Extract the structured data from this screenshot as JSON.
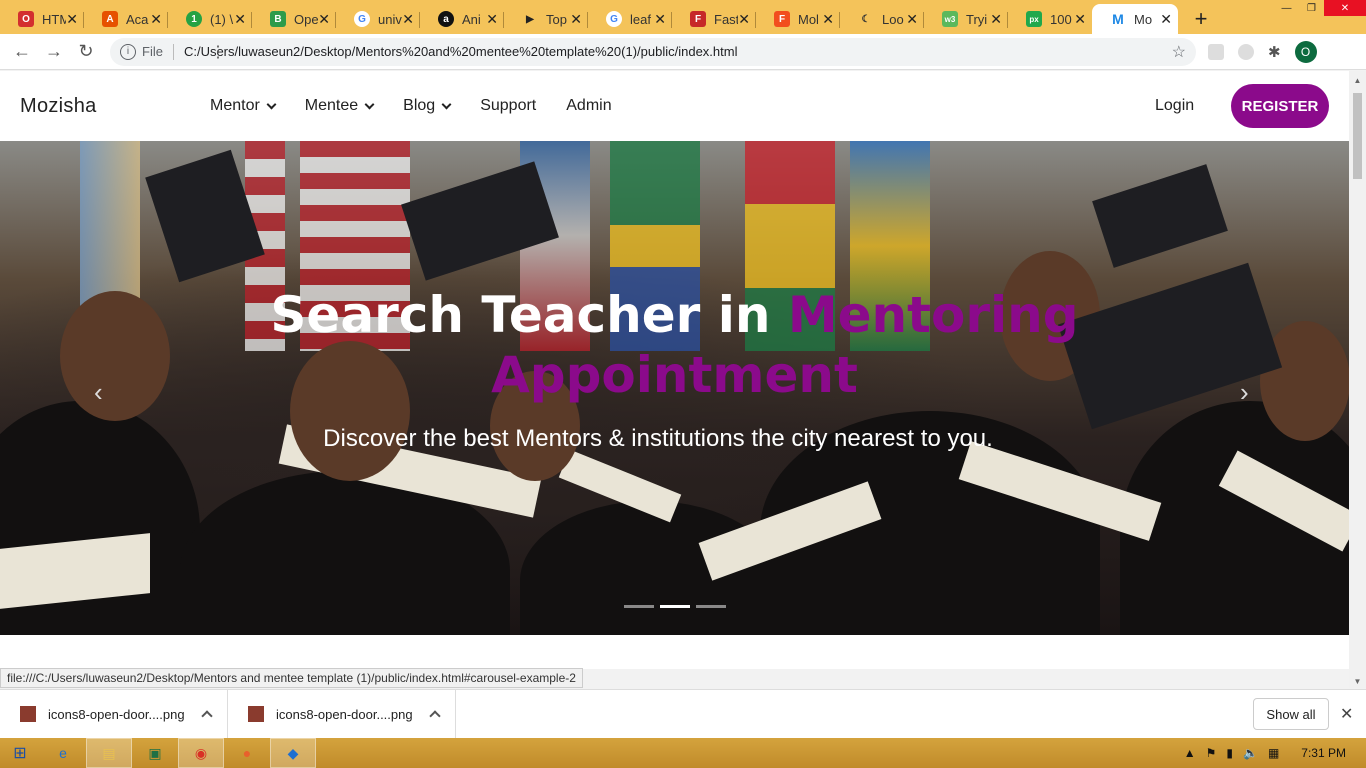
{
  "browser": {
    "tabs": [
      {
        "title": "HTM",
        "color": "#d32f2f",
        "glyph": "O"
      },
      {
        "title": "Aca",
        "color": "#e65100",
        "glyph": "A"
      },
      {
        "title": "(1) \\",
        "color": "#25a244",
        "glyph": "1"
      },
      {
        "title": "Ope",
        "color": "#2e9b4a",
        "glyph": "B"
      },
      {
        "title": "univ",
        "color": "#4285f4",
        "glyph": "G"
      },
      {
        "title": "Ani",
        "color": "#111111",
        "glyph": "a"
      },
      {
        "title": "Top",
        "color": "#222222",
        "glyph": "▶"
      },
      {
        "title": "leaf",
        "color": "#4285f4",
        "glyph": "G"
      },
      {
        "title": "Fast",
        "color": "#c62828",
        "glyph": "F"
      },
      {
        "title": "Mol",
        "color": "#f24e1e",
        "glyph": "F"
      },
      {
        "title": "Loo",
        "color": "#333333",
        "glyph": "☾"
      },
      {
        "title": "Tryi",
        "color": "#5cb85c",
        "glyph": "w3"
      },
      {
        "title": "100",
        "color": "#20a84c",
        "glyph": "px"
      },
      {
        "title": "Mo",
        "color": "#1e88e5",
        "glyph": "M"
      }
    ],
    "address": {
      "scheme_label": "File",
      "url": "C:/Users/luwaseun2/Desktop/Mentors%20and%20mentee%20template%20(1)/public/index.html"
    },
    "profile_initial": "O",
    "status_url": "file:///C:/Users/luwaseun2/Desktop/Mentors and mentee template (1)/public/index.html#carousel-example-2"
  },
  "site": {
    "brand": "Mozisha",
    "nav": [
      {
        "label": "Mentor",
        "dropdown": true
      },
      {
        "label": "Mentee",
        "dropdown": true
      },
      {
        "label": "Blog",
        "dropdown": true
      },
      {
        "label": "Support",
        "dropdown": false
      },
      {
        "label": "Admin",
        "dropdown": false
      }
    ],
    "login": "Login",
    "register": "REGISTER",
    "accent_color": "#8b0a8b"
  },
  "hero": {
    "title_white": "Search Teacher in ",
    "title_accent_1": "Mentoring",
    "title_accent_2": "Appointment",
    "subtitle": "Discover the best Mentors & institutions the city nearest to you.",
    "slides": 3,
    "active_slide": 2
  },
  "downloads": {
    "items": [
      {
        "name": "icons8-open-door....png"
      },
      {
        "name": "icons8-open-door....png"
      }
    ],
    "show_all": "Show all"
  },
  "taskbar": {
    "clock": "7:31 PM"
  }
}
